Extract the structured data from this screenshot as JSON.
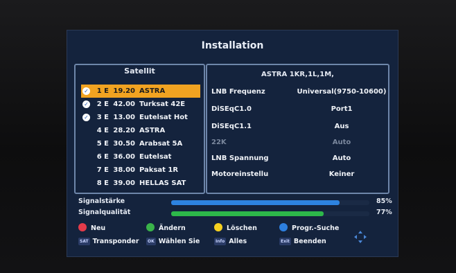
{
  "screen": {
    "title": "Installation"
  },
  "satellite_list": {
    "header": "Satellit",
    "items": [
      {
        "num": "1 E",
        "position": "19.20",
        "name": "ASTRA",
        "checked": true,
        "selected": true
      },
      {
        "num": "2 E",
        "position": "42.00",
        "name": "Turksat 42E",
        "checked": true,
        "selected": false
      },
      {
        "num": "3 E",
        "position": "13.00",
        "name": "Eutelsat Hot",
        "checked": true,
        "selected": false
      },
      {
        "num": "4 E",
        "position": "28.20",
        "name": "ASTRA",
        "checked": false,
        "selected": false
      },
      {
        "num": "5 E",
        "position": "30.50",
        "name": "Arabsat 5A",
        "checked": false,
        "selected": false
      },
      {
        "num": "6 E",
        "position": "36.00",
        "name": "Eutelsat",
        "checked": false,
        "selected": false
      },
      {
        "num": "7 E",
        "position": "38.00",
        "name": "Paksat 1R",
        "checked": false,
        "selected": false
      },
      {
        "num": "8 E",
        "position": "39.00",
        "name": "HELLAS SAT",
        "checked": false,
        "selected": false
      }
    ]
  },
  "info_panel": {
    "header": "ASTRA 1KR,1L,1M,",
    "rows": [
      {
        "label": "LNB Frequenz",
        "value": "Universal(9750-10600)",
        "disabled": false
      },
      {
        "label": "DiSEqC1.0",
        "value": "Port1",
        "disabled": false
      },
      {
        "label": "DiSEqC1.1",
        "value": "Aus",
        "disabled": false
      },
      {
        "label": "22K",
        "value": "Auto",
        "disabled": true
      },
      {
        "label": "LNB Spannung",
        "value": "Auto",
        "disabled": false
      },
      {
        "label": "Motoreinstellu",
        "value": "Keiner",
        "disabled": false
      }
    ]
  },
  "signal": {
    "strength_label": "Signalstärke",
    "strength_percent": 85,
    "strength_text": "85%",
    "quality_label": "Signalqualität",
    "quality_percent": 77,
    "quality_text": "77%"
  },
  "keys": {
    "red": "Neu",
    "green": "Ändern",
    "yellow": "Löschen",
    "blue": "Progr.-Suche",
    "sat_btn": "SAT",
    "sat_label": "Transponder",
    "ok_btn": "OK",
    "ok_label": "Wählen Sie",
    "info_btn": "Info",
    "info_label": "Alles",
    "exit_btn": "Exit",
    "exit_label": "Beenden"
  },
  "colors": {
    "panel_bg": "#14233d",
    "selected_row": "#f1a321",
    "strength_bar": "#2d83e0",
    "quality_bar": "#2db84a",
    "red_key": "#e43b4a",
    "green_key": "#3ab34a",
    "yellow_key": "#f5d020",
    "blue_key": "#2d7fe0"
  }
}
